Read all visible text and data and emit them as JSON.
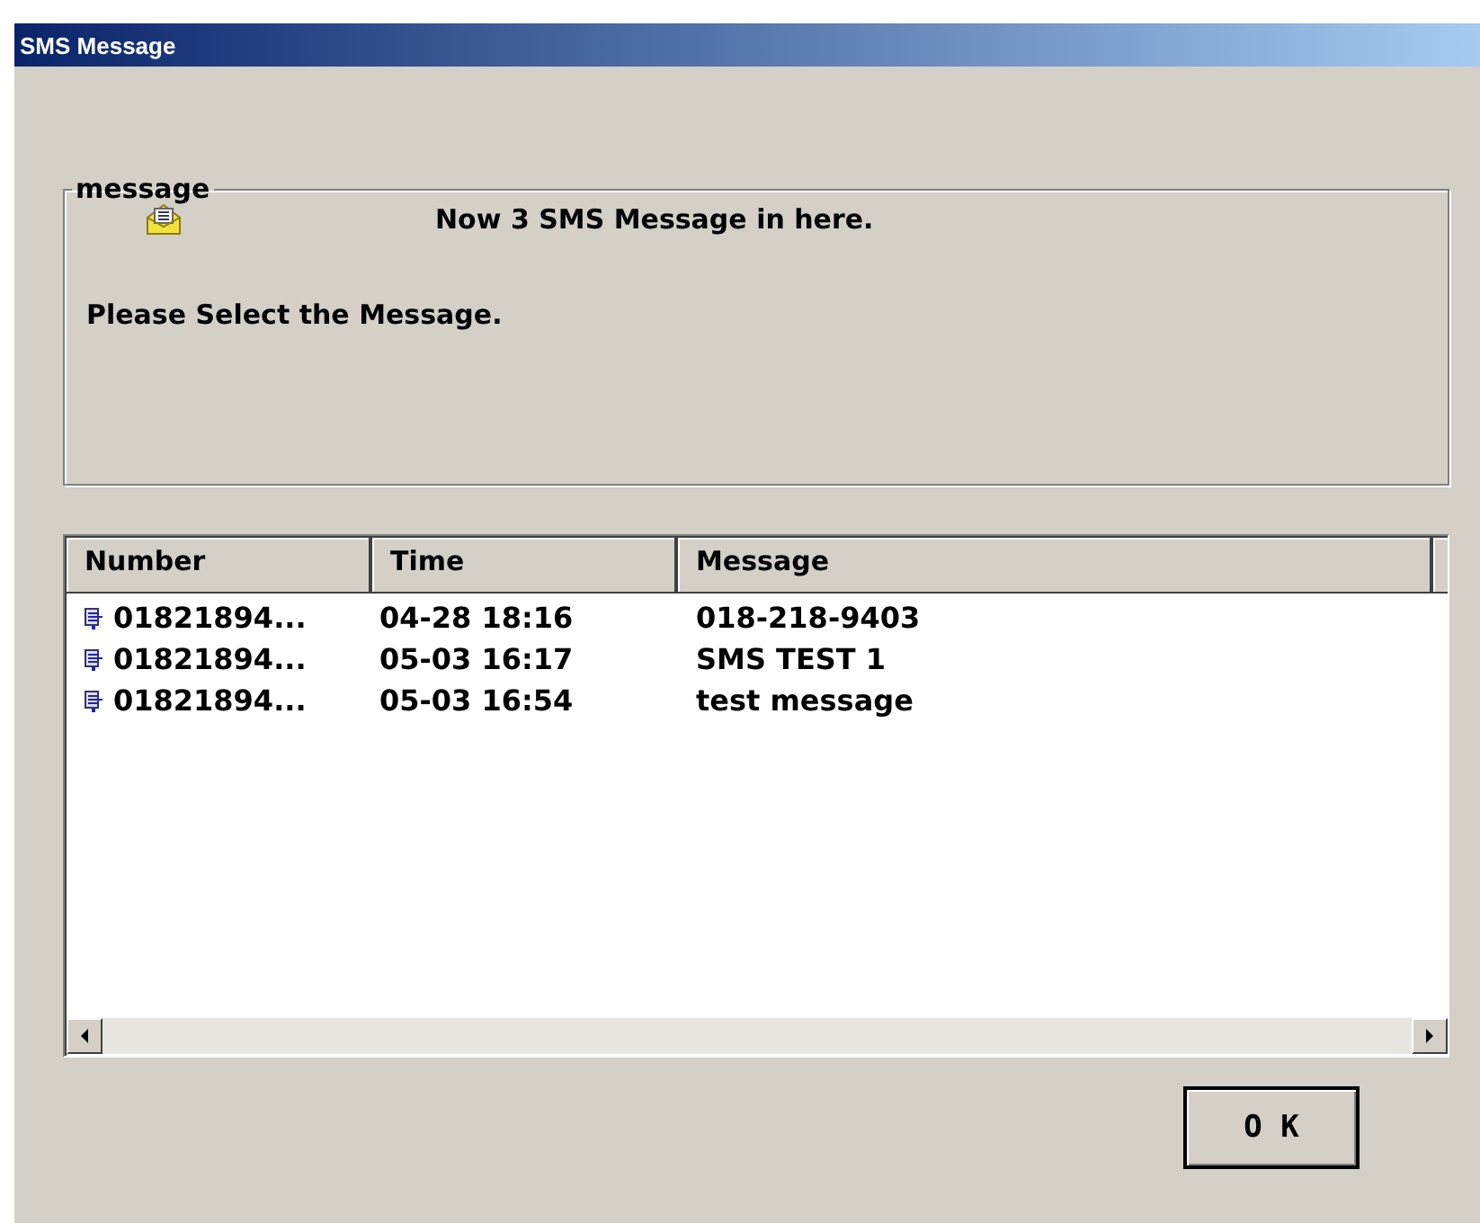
{
  "window": {
    "title": "SMS Message"
  },
  "group": {
    "label": "message",
    "count_text": "Now 3 SMS Message in here.",
    "prompt": "Please Select the Message."
  },
  "list": {
    "columns": [
      "Number",
      "Time",
      "Message"
    ],
    "rows": [
      {
        "number": "01821894...",
        "time": "04-28 18:16",
        "message": "018-218-9403"
      },
      {
        "number": "01821894...",
        "time": "05-03 16:17",
        "message": "SMS TEST 1"
      },
      {
        "number": "01821894...",
        "time": "05-03 16:54",
        "message": "test message"
      }
    ]
  },
  "buttons": [
    "O K"
  ]
}
